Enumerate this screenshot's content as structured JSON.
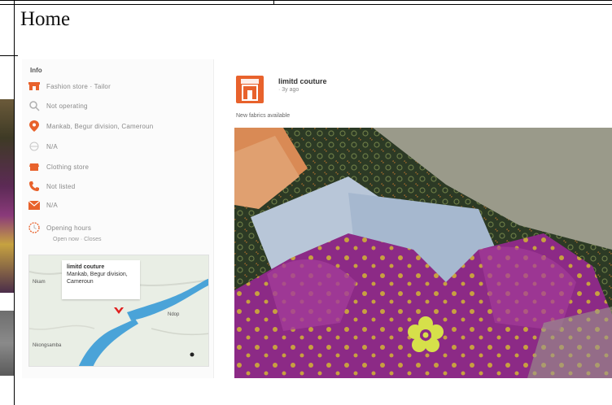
{
  "page": {
    "heading": "Home"
  },
  "info_card": {
    "title": "Info",
    "rows": [
      {
        "icon": "store-icon",
        "text": "Fashion store · Tailor"
      },
      {
        "icon": "search-icon",
        "text": "Not operating"
      },
      {
        "icon": "location-pin-icon",
        "text": "Mankab, Begur division, Cameroun"
      },
      {
        "icon": "globe-icon",
        "text": "N/A"
      },
      {
        "icon": "category-icon",
        "text": "Clothing store"
      },
      {
        "icon": "phone-icon",
        "text": "Not listed"
      },
      {
        "icon": "mail-icon",
        "text": "N/A"
      },
      {
        "icon": "clock-icon",
        "text": "Opening hours"
      }
    ],
    "hours_subtext": "Open now · Closes",
    "map": {
      "callout_lines": [
        "limitd couture",
        "Mankab, Begur division,",
        "Cameroun"
      ],
      "labels": [
        "Nkam",
        "Nkongsamba",
        "Ndop"
      ]
    }
  },
  "post": {
    "author": "limitd couture",
    "time": "· 3y ago",
    "caption": "New fabrics available",
    "photo_alt": "Purple floral fabric with yellow flowers on a patterned carpet"
  },
  "colors": {
    "accent": "#e8622c",
    "icon_grey": "#b0b0b0",
    "fabric_purple": "#8c2a86",
    "flower_yellow": "#d6e04a"
  }
}
